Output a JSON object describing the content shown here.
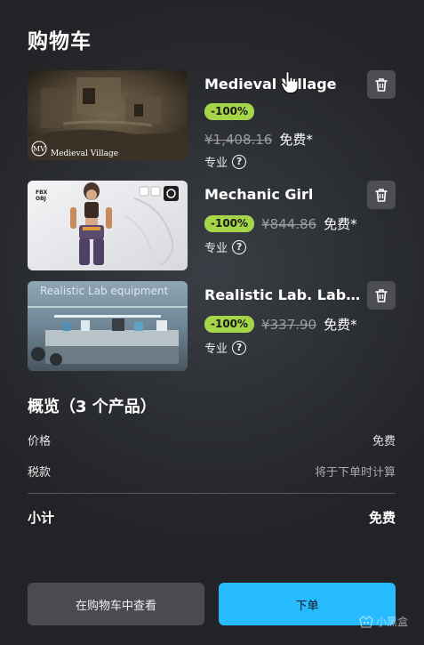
{
  "header": {
    "title": "购物车"
  },
  "cart": {
    "items": [
      {
        "name": "Medieval Village",
        "discount": "-100%",
        "original_price": "¥1,408.16",
        "final_price": "免费*",
        "license": "专业",
        "thumb_caption": "Medieval Village"
      },
      {
        "name": "Mechanic Girl",
        "discount": "-100%",
        "original_price": "¥844.86",
        "final_price": "免费*",
        "license": "专业",
        "thumb_badges": [
          "FBX",
          "OBJ"
        ]
      },
      {
        "name": "Realistic Lab. Laboratory",
        "discount": "-100%",
        "original_price": "¥337.90",
        "final_price": "免费*",
        "license": "专业",
        "thumb_caption": "Realistic Lab equipment"
      }
    ]
  },
  "overview": {
    "title": "概览（3 个产品）",
    "price_label": "价格",
    "price_value": "免费",
    "tax_label": "税款",
    "tax_value": "将于下单时计算",
    "subtotal_label": "小计",
    "subtotal_value": "免费"
  },
  "actions": {
    "view_cart": "在购物车中查看",
    "place_order": "下单"
  },
  "watermark": {
    "text": "小黑盒"
  },
  "colors": {
    "badge": "#a5d64a",
    "primary_button": "#26bbff",
    "secondary_button": "#4a4b4e",
    "icon_button": "#4c4e52"
  }
}
